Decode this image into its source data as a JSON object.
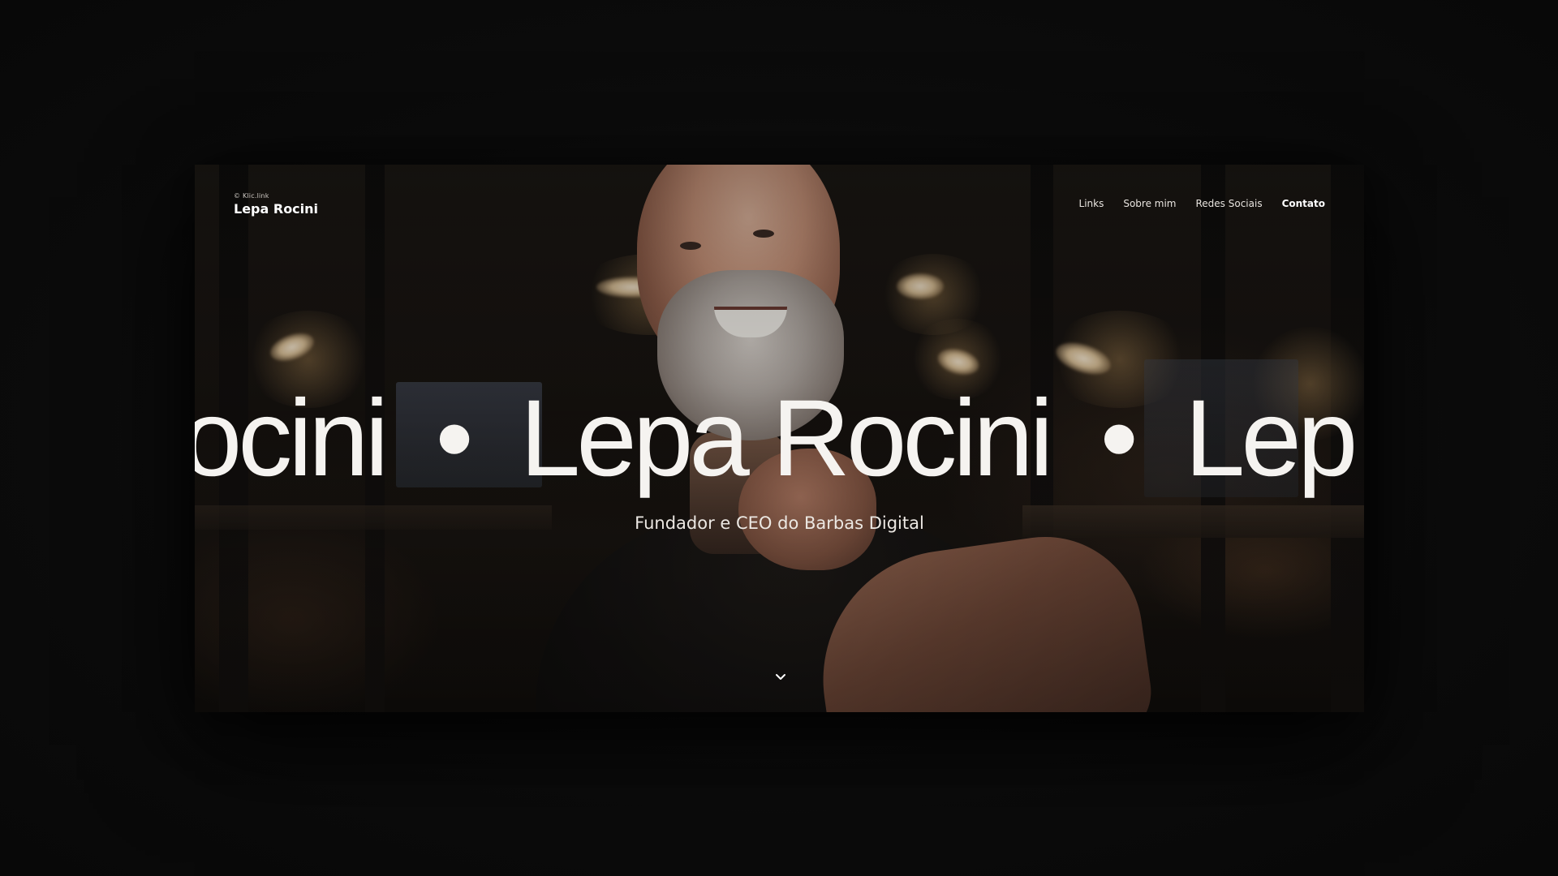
{
  "header": {
    "copyright": "© Klic.link",
    "site_name": "Lepa Rocini"
  },
  "nav": {
    "items": [
      {
        "label": "Links"
      },
      {
        "label": "Sobre mim"
      },
      {
        "label": "Redes Sociais"
      },
      {
        "label": "Contato"
      }
    ]
  },
  "hero": {
    "marquee_segments": [
      "Rocini",
      "•",
      "Lepa Rocini",
      "•",
      "Lep"
    ],
    "subtitle": "Fundador e CEO do Barbas Digital"
  },
  "icons": {
    "scroll_down": "chevron-down-icon"
  },
  "colors": {
    "page_background": "#0b0b0b",
    "text_primary": "#ffffff"
  }
}
